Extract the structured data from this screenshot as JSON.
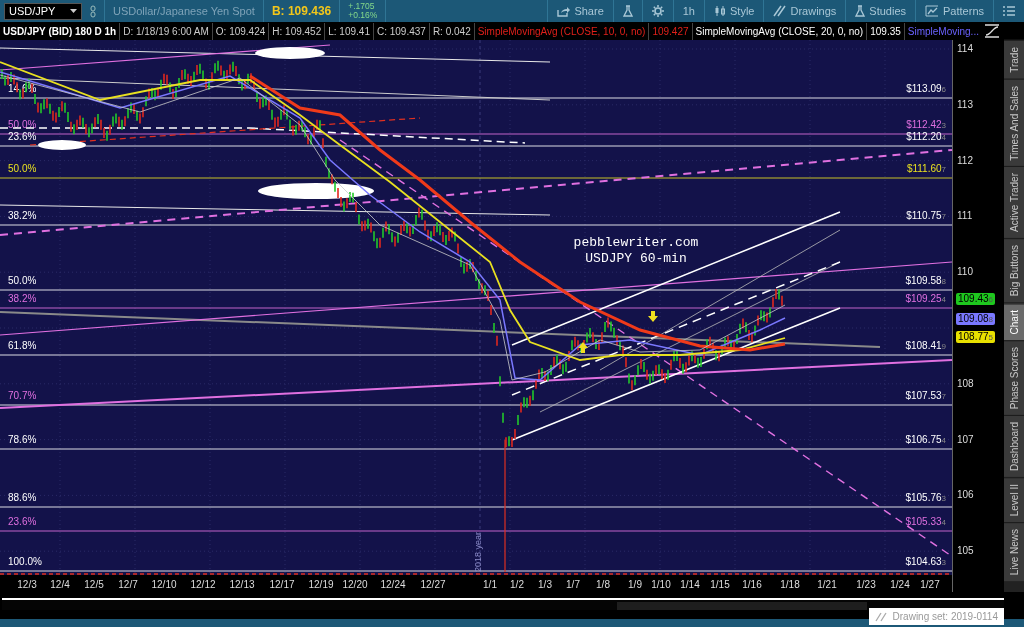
{
  "toolbar": {
    "symbol": "USD/JPY",
    "description": "USDollar/Japanese Yen Spot",
    "bid": "B: 109.436",
    "change": "+.1705",
    "change_percent": "+0.16%",
    "buttons": [
      {
        "kind": "share",
        "label": "Share"
      },
      {
        "kind": "flask"
      },
      {
        "kind": "gear"
      },
      {
        "kind": "text",
        "label": "1h"
      },
      {
        "kind": "style",
        "label": "Style"
      },
      {
        "kind": "drawings",
        "label": "Drawings"
      },
      {
        "kind": "flask",
        "label": "Studies"
      },
      {
        "kind": "patterns",
        "label": "Patterns"
      },
      {
        "kind": "menu"
      }
    ]
  },
  "info_bar": [
    {
      "text": "USD/JPY (BID) 180 D 1h",
      "kind": "title"
    },
    {
      "text": "D: 1/18/19 6:00 AM",
      "kind": "quote"
    },
    {
      "text": "O: 109.424",
      "kind": "quote"
    },
    {
      "text": "H: 109.452",
      "kind": "quote"
    },
    {
      "text": "L: 109.41",
      "kind": "quote"
    },
    {
      "text": "C: 109.437",
      "kind": "quote"
    },
    {
      "text": "R: 0.042",
      "kind": "quote"
    },
    {
      "text": "SimpleMovingAvg (CLOSE, 10, 0, no)",
      "kind": "sma10"
    },
    {
      "text": "109.427",
      "kind": "sma10"
    },
    {
      "text": "SimpleMovingAvg (CLOSE, 20, 0, no)",
      "kind": "sma20"
    },
    {
      "text": "109.35",
      "kind": "sma20"
    },
    {
      "text": "SimpleMoving...",
      "kind": "sma_next"
    }
  ],
  "chart": {
    "annotation": [
      "pebblewriter.com",
      "USDJPY 60-min"
    ],
    "year_marker": "2018 year",
    "levels": [
      {
        "percent": {
          "text": "14.6%",
          "kind": "plain"
        },
        "price": {
          "text": "$113.096",
          "kind": "plain"
        }
      },
      {
        "percent": {
          "text": "50.0%",
          "kind": "pink"
        },
        "price": {
          "text": "$112.423",
          "kind": "pink"
        }
      },
      {
        "percent": {
          "text": "23.6%",
          "kind": "plain"
        },
        "price": {
          "text": "$112.204",
          "kind": "plain"
        }
      },
      {
        "percent": {
          "text": "50.0%",
          "kind": "gold"
        },
        "price": {
          "text": "$111.607",
          "kind": "gold"
        }
      },
      {
        "percent": {
          "text": "38.2%",
          "kind": "plain"
        },
        "price": {
          "text": "$110.757",
          "kind": "plain"
        }
      },
      {
        "percent": {
          "text": "50.0%",
          "kind": "plain"
        },
        "price": {
          "text": "$109.588",
          "kind": "plain"
        }
      },
      {
        "percent": {
          "text": "38.2%",
          "kind": "pink"
        },
        "price": {
          "text": "$109.254",
          "kind": "pink"
        }
      },
      {
        "percent": {
          "text": "61.8%",
          "kind": "plain"
        },
        "price": {
          "text": "$108.419",
          "kind": "plain"
        }
      },
      {
        "percent": {
          "text": "70.7%",
          "kind": "pink"
        },
        "price": {
          "text": "$107.537",
          "kind": "plain"
        }
      },
      {
        "percent": {
          "text": "78.6%",
          "kind": "plain"
        },
        "price": {
          "text": "$106.754",
          "kind": "plain"
        }
      },
      {
        "percent": {
          "text": "88.6%",
          "kind": "plain"
        },
        "price": {
          "text": "$105.763",
          "kind": "plain"
        }
      },
      {
        "percent": {
          "text": "23.6%",
          "kind": "pink"
        },
        "price": {
          "text": "$105.334",
          "kind": "pink"
        }
      },
      {
        "percent": {
          "text": "100.0%",
          "kind": "plain"
        },
        "price": {
          "text": "$104.633",
          "kind": "plain"
        }
      }
    ],
    "y_ticks": [
      "114",
      "113",
      "112",
      "111",
      "110",
      "108",
      "107",
      "106",
      "105"
    ],
    "price_tags": [
      {
        "text": "109.436",
        "color": "#1ec81e"
      },
      {
        "text": "109.088",
        "color": "#7a78ff"
      },
      {
        "text": "108.775",
        "color": "#e8e000"
      }
    ],
    "x_ticks": [
      "12/3",
      "12/4",
      "12/5",
      "12/7",
      "12/10",
      "12/12",
      "12/13",
      "12/17",
      "12/19",
      "12/20",
      "12/24",
      "12/27",
      "1/1",
      "1/2",
      "1/3",
      "1/7",
      "1/8",
      "1/9",
      "1/10",
      "1/14",
      "1/15",
      "1/16",
      "1/18",
      "1/21",
      "1/23",
      "1/24",
      "1/27"
    ]
  },
  "side_tabs": [
    {
      "label": "Trade",
      "selected": false
    },
    {
      "label": "Times And Sales",
      "selected": false
    },
    {
      "label": "Active Trader",
      "selected": false
    },
    {
      "label": "Big Buttons",
      "selected": false
    },
    {
      "label": "Chart",
      "selected": true
    },
    {
      "label": "Phase Scores",
      "selected": false
    },
    {
      "label": "Dashboard",
      "selected": false
    },
    {
      "label": "Level II",
      "selected": false
    },
    {
      "label": "Live News",
      "selected": false
    }
  ],
  "footer": {
    "drawing_set": "Drawing set: 2019-0114"
  }
}
